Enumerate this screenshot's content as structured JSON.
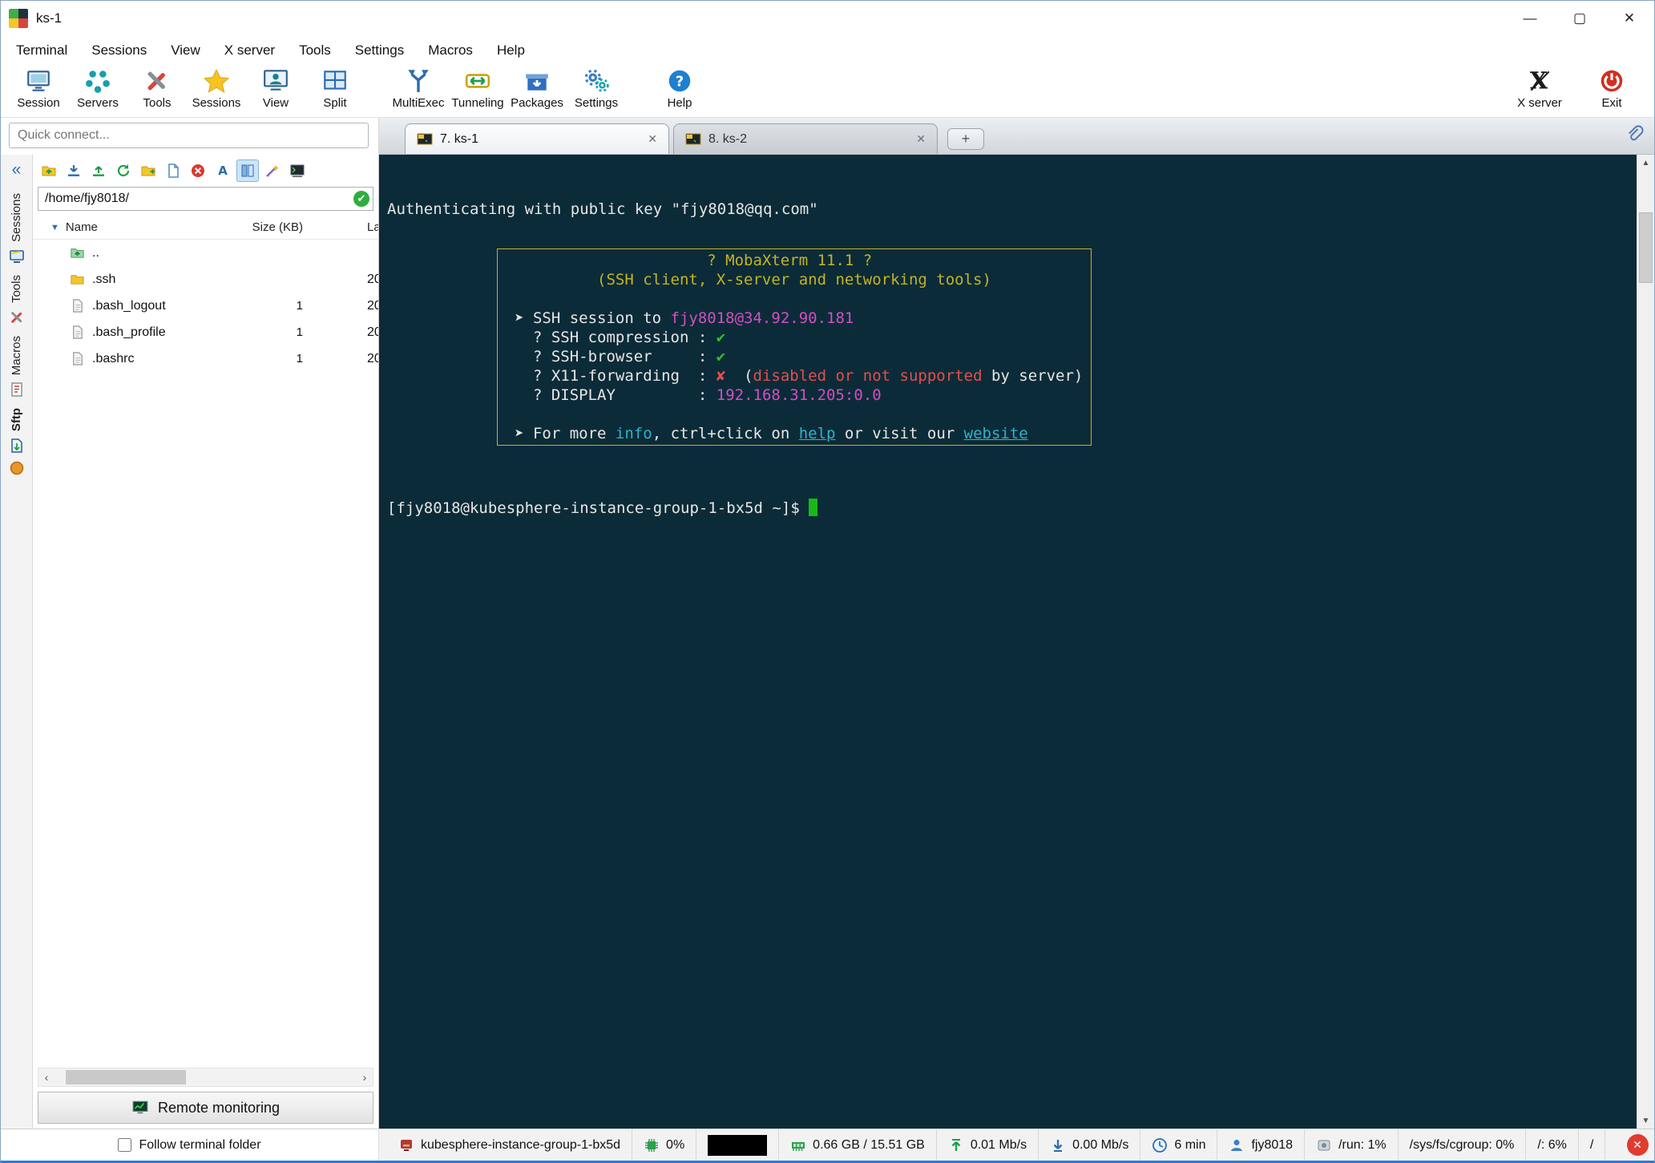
{
  "window": {
    "title": "ks-1",
    "controls": {
      "minimize": "—",
      "maximize": "▢",
      "close": "✕"
    }
  },
  "menu_bar": {
    "items": [
      "Terminal",
      "Sessions",
      "View",
      "X server",
      "Tools",
      "Settings",
      "Macros",
      "Help"
    ]
  },
  "toolbar": {
    "left_items": [
      {
        "label": "Session",
        "icon": "session-icon"
      },
      {
        "label": "Servers",
        "icon": "servers-icon"
      },
      {
        "label": "Tools",
        "icon": "tools-icon"
      },
      {
        "label": "Sessions",
        "icon": "sessions-star-icon"
      },
      {
        "label": "View",
        "icon": "view-icon"
      },
      {
        "label": "Split",
        "icon": "split-icon"
      },
      {
        "label": "MultiExec",
        "icon": "multiexec-icon"
      },
      {
        "label": "Tunneling",
        "icon": "tunneling-icon"
      },
      {
        "label": "Packages",
        "icon": "packages-icon"
      },
      {
        "label": "Settings",
        "icon": "settings-icon"
      },
      {
        "label": "Help",
        "icon": "help-icon"
      }
    ],
    "right_items": [
      {
        "label": "X server",
        "icon": "xserver-icon"
      },
      {
        "label": "Exit",
        "icon": "exit-icon"
      }
    ]
  },
  "quick_connect": {
    "placeholder": "Quick connect..."
  },
  "tab_bar": {
    "tabs": [
      {
        "label": "7. ks-1",
        "active": true
      },
      {
        "label": "8. ks-2",
        "active": false
      }
    ],
    "new_tab": "+"
  },
  "side_strip": {
    "collapse": "«",
    "tabs": [
      {
        "label": "Sessions",
        "icon": "sessions-tab-icon",
        "active": false
      },
      {
        "label": "Tools",
        "icon": "tools-tab-icon",
        "active": false
      },
      {
        "label": "Macros",
        "icon": "macros-tab-icon",
        "active": false
      },
      {
        "label": "Sftp",
        "icon": "sftp-tab-icon",
        "active": true
      }
    ]
  },
  "sftp_panel": {
    "toolbar_icons": [
      "folder-up-icon",
      "download-icon",
      "upload-icon",
      "refresh-icon",
      "new-folder-icon",
      "new-file-icon",
      "delete-icon",
      "rename-icon",
      "panes-icon",
      "wand-icon",
      "terminal-follow-icon"
    ],
    "pressed_icon": "panes-icon",
    "path_value": "/home/fjy8018/",
    "columns": {
      "name": "Name",
      "size": "Size (KB)",
      "last": "La"
    },
    "rows": [
      {
        "icon": "folder-up",
        "name": "..",
        "size": "",
        "last": ""
      },
      {
        "icon": "folder",
        "name": ".ssh",
        "size": "",
        "last": "20"
      },
      {
        "icon": "file",
        "name": ".bash_logout",
        "size": "1",
        "last": "20"
      },
      {
        "icon": "file",
        "name": ".bash_profile",
        "size": "1",
        "last": "20"
      },
      {
        "icon": "file",
        "name": ".bashrc",
        "size": "1",
        "last": "20"
      }
    ],
    "remote_monitoring_label": "Remote monitoring",
    "follow_terminal_label": "Follow terminal folder"
  },
  "terminal": {
    "auth_line": "Authenticating with public key \"fjy8018@qq.com\"",
    "banner": {
      "lines": [
        [
          {
            "t": "                      ? MobaXterm 11.1 ?",
            "c": "yellow"
          }
        ],
        [
          {
            "t": "          (SSH client, X-server and networking tools)",
            "c": "yellow"
          }
        ],
        [
          {
            "t": " ",
            "c": "fg"
          }
        ],
        [
          {
            "t": " ➤ SSH session to ",
            "c": "fg"
          },
          {
            "t": "fjy8018@34.92.90.181",
            "c": "magenta"
          }
        ],
        [
          {
            "t": "   ? SSH compression : ",
            "c": "fg"
          },
          {
            "t": "✔",
            "c": "green"
          }
        ],
        [
          {
            "t": "   ? SSH-browser     : ",
            "c": "fg"
          },
          {
            "t": "✔",
            "c": "green"
          }
        ],
        [
          {
            "t": "   ? X11-forwarding  : ",
            "c": "fg"
          },
          {
            "t": "✘",
            "c": "red"
          },
          {
            "t": "  (",
            "c": "fg"
          },
          {
            "t": "disabled or not supported",
            "c": "red"
          },
          {
            "t": " by server)",
            "c": "fg"
          }
        ],
        [
          {
            "t": "   ? DISPLAY         : ",
            "c": "fg"
          },
          {
            "t": "192.168.31.205:0.0",
            "c": "magenta"
          }
        ],
        [
          {
            "t": " ",
            "c": "fg"
          }
        ],
        [
          {
            "t": " ➤ For more ",
            "c": "fg"
          },
          {
            "t": "info",
            "c": "cyan"
          },
          {
            "t": ", ctrl+click on ",
            "c": "fg"
          },
          {
            "t": "help",
            "c": "cyan",
            "u": true
          },
          {
            "t": " or visit our ",
            "c": "fg"
          },
          {
            "t": "website",
            "c": "cyan",
            "u": true
          }
        ]
      ]
    },
    "prompt": "[fjy8018@kubesphere-instance-group-1-bx5d ~]$",
    "colors": {
      "bg": "#0c2b38",
      "fg": "#e6e6e6",
      "yellow": "#c3b424",
      "magenta": "#d24fc0",
      "green": "#2ec22e",
      "red": "#e34f4f",
      "cyan": "#2fb2cd"
    }
  },
  "status_bar": {
    "items": [
      {
        "icon": "host-icon",
        "text": "kubesphere-instance-group-1-bx5d"
      },
      {
        "icon": "cpu-icon",
        "text": "0%"
      },
      {
        "icon": "graph",
        "text": ""
      },
      {
        "icon": "ram-icon",
        "text": "0.66 GB / 15.51 GB"
      },
      {
        "icon": "up-arrow-icon",
        "text": "0.01 Mb/s"
      },
      {
        "icon": "down-arrow-icon",
        "text": "0.00 Mb/s"
      },
      {
        "icon": "clock-icon",
        "text": "6 min"
      },
      {
        "icon": "user-icon",
        "text": "fjy8018"
      },
      {
        "icon": "disk-icon",
        "text": "/run: 1%"
      },
      {
        "icon": "",
        "text": "/sys/fs/cgroup: 0%"
      },
      {
        "icon": "",
        "text": "/: 6%"
      },
      {
        "icon": "",
        "text": "/"
      }
    ],
    "close_glyph": "✕"
  }
}
